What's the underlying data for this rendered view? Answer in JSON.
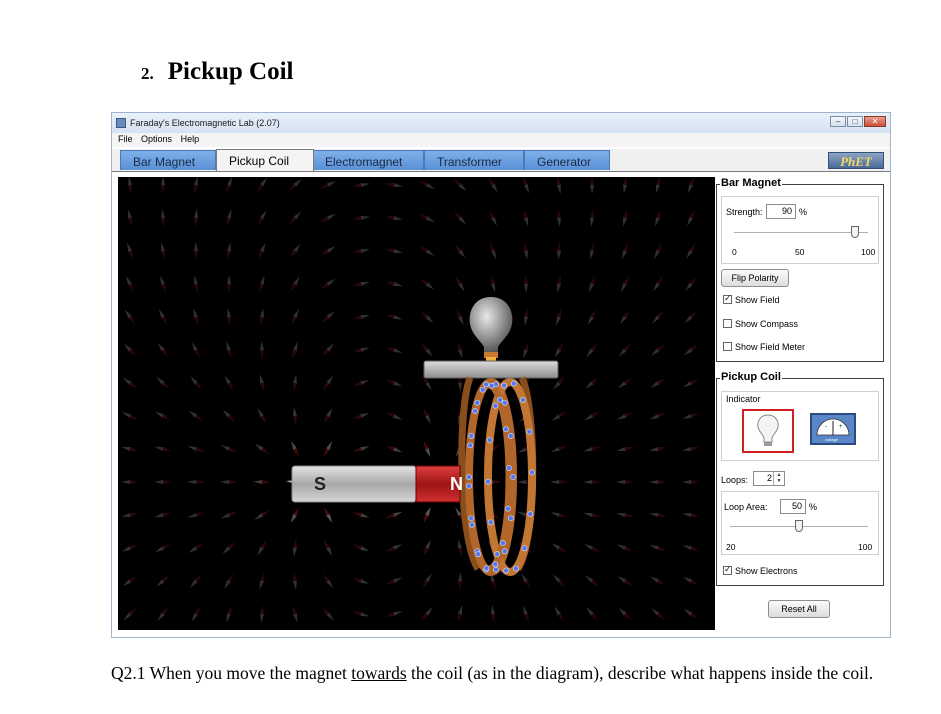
{
  "document": {
    "section_number": "2.",
    "section_title": "Pickup Coil",
    "question_prefix": "Q2.1 When you move the magnet ",
    "question_underlined": "towards",
    "question_suffix": " the coil (as in the diagram), describe what happens inside the coil."
  },
  "window": {
    "title": "Faraday's Electromagnetic Lab (2.07)",
    "menu": [
      "File",
      "Options",
      "Help"
    ],
    "tabs": [
      {
        "label": "Bar Magnet",
        "active": false
      },
      {
        "label": "Pickup Coil",
        "active": true
      },
      {
        "label": "Electromagnet",
        "active": false
      },
      {
        "label": "Transformer",
        "active": false
      },
      {
        "label": "Generator",
        "active": false
      }
    ],
    "logo_text": "PhET"
  },
  "simulation": {
    "magnet_south_label": "S",
    "magnet_north_label": "N",
    "colors": {
      "background": "#000000",
      "north": "#c8201f",
      "south": "#c8c8c8",
      "coil": "#b2662a",
      "electron": "#4a6fe0"
    }
  },
  "bar_magnet_panel": {
    "title": "Bar Magnet",
    "strength_label": "Strength:",
    "strength_value": "90",
    "strength_unit": "%",
    "strength_fraction": 0.9,
    "tick_min": "0",
    "tick_mid": "50",
    "tick_max": "100",
    "flip_button": "Flip Polarity",
    "checkboxes": [
      {
        "label": "Show Field",
        "checked": true
      },
      {
        "label": "Show Compass",
        "checked": false
      },
      {
        "label": "Show Field Meter",
        "checked": false
      }
    ]
  },
  "pickup_coil_panel": {
    "title": "Pickup Coil",
    "indicator_label": "Indicator",
    "voltmeter_caption": "voltage",
    "loops_label": "Loops:",
    "loops_value": "2",
    "loop_area_label": "Loop Area:",
    "loop_area_value": "50",
    "loop_area_unit": "%",
    "loop_area_fraction": 0.5,
    "tick_min": "20",
    "tick_max": "100",
    "show_electrons": {
      "label": "Show Electrons",
      "checked": true
    }
  },
  "reset_button": "Reset All"
}
